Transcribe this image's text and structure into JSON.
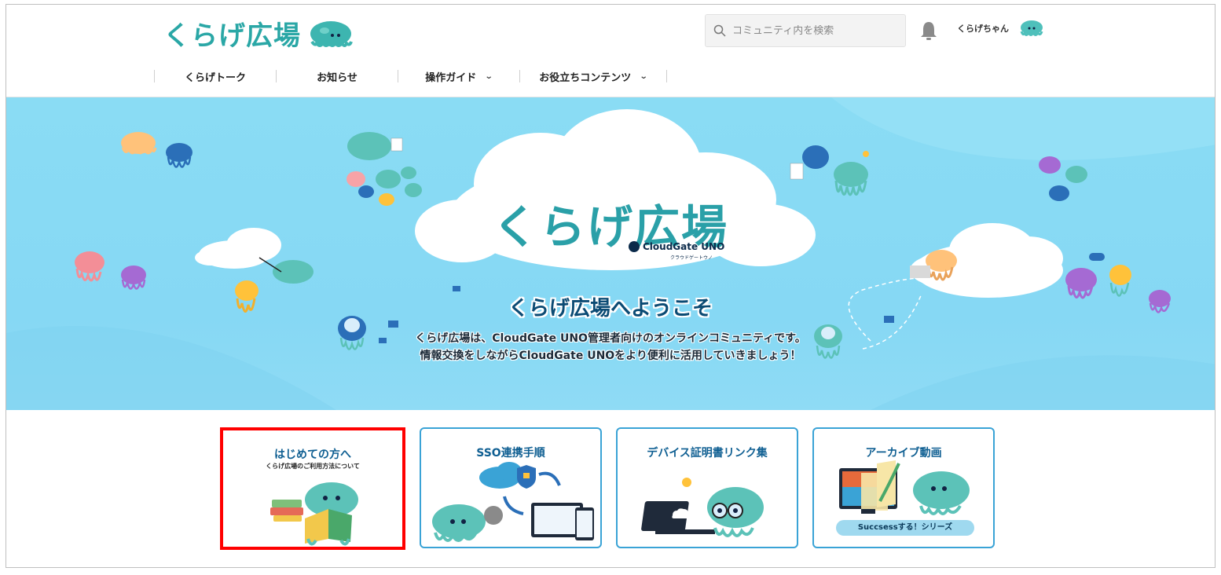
{
  "header": {
    "logo_text": "くらげ広場",
    "search_placeholder": "コミュニティ内を検索",
    "user_name": "くらげちゃん"
  },
  "nav": [
    {
      "label": "くらげトーク",
      "has_dropdown": false
    },
    {
      "label": "お知らせ",
      "has_dropdown": false
    },
    {
      "label": "操作ガイド",
      "has_dropdown": true
    },
    {
      "label": "お役立ちコンテンツ",
      "has_dropdown": true
    }
  ],
  "hero": {
    "logo_text": "くらげ広場",
    "brand": "CloudGate UNO",
    "brand_sub": "クラウドゲートウノ",
    "title": "くらげ広場へようこそ",
    "desc_line1": "くらげ広場は、CloudGate UNO管理者向けのオンラインコミュニティです。",
    "desc_line2": "情報交換をしながらCloudGate UNOをより便利に活用していきましょう！"
  },
  "cards": [
    {
      "title": "はじめての方へ",
      "subtitle": "くらげ広場のご利用方法について",
      "highlighted": true
    },
    {
      "title": "SSO連携手順",
      "subtitle": "",
      "highlighted": false
    },
    {
      "title": "デバイス証明書リンク集",
      "subtitle": "",
      "highlighted": false
    },
    {
      "title": "アーカイブ動画",
      "subtitle": "",
      "label": "Succsessする！シリーズ",
      "highlighted": false
    }
  ],
  "colors": {
    "brand_teal": "#2aa7a6",
    "hero_sky": "#8adcf4",
    "card_border": "#3aa3d6",
    "highlight_red": "#ff0000",
    "title_navy": "#0f5f92"
  },
  "icons": {
    "search": "search-icon",
    "bell": "bell-icon",
    "avatar": "jellyfish-avatar-icon",
    "chevron": "chevron-down-icon"
  }
}
